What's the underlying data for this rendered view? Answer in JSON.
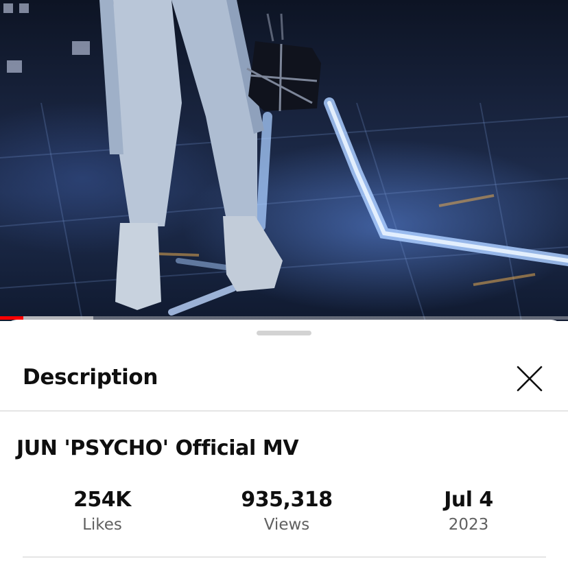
{
  "video": {
    "progress_fraction": 0.041,
    "buffered_fraction": 0.164,
    "progress_color": "#ff0000"
  },
  "sheet": {
    "title": "Description",
    "close_icon": "close-icon"
  },
  "description": {
    "video_title": "JUN 'PSYCHO' Official MV",
    "stats": {
      "likes_value": "254K",
      "likes_label": "Likes",
      "views_value": "935,318",
      "views_label": "Views",
      "date_value": "Jul 4",
      "date_label": "2023"
    }
  }
}
